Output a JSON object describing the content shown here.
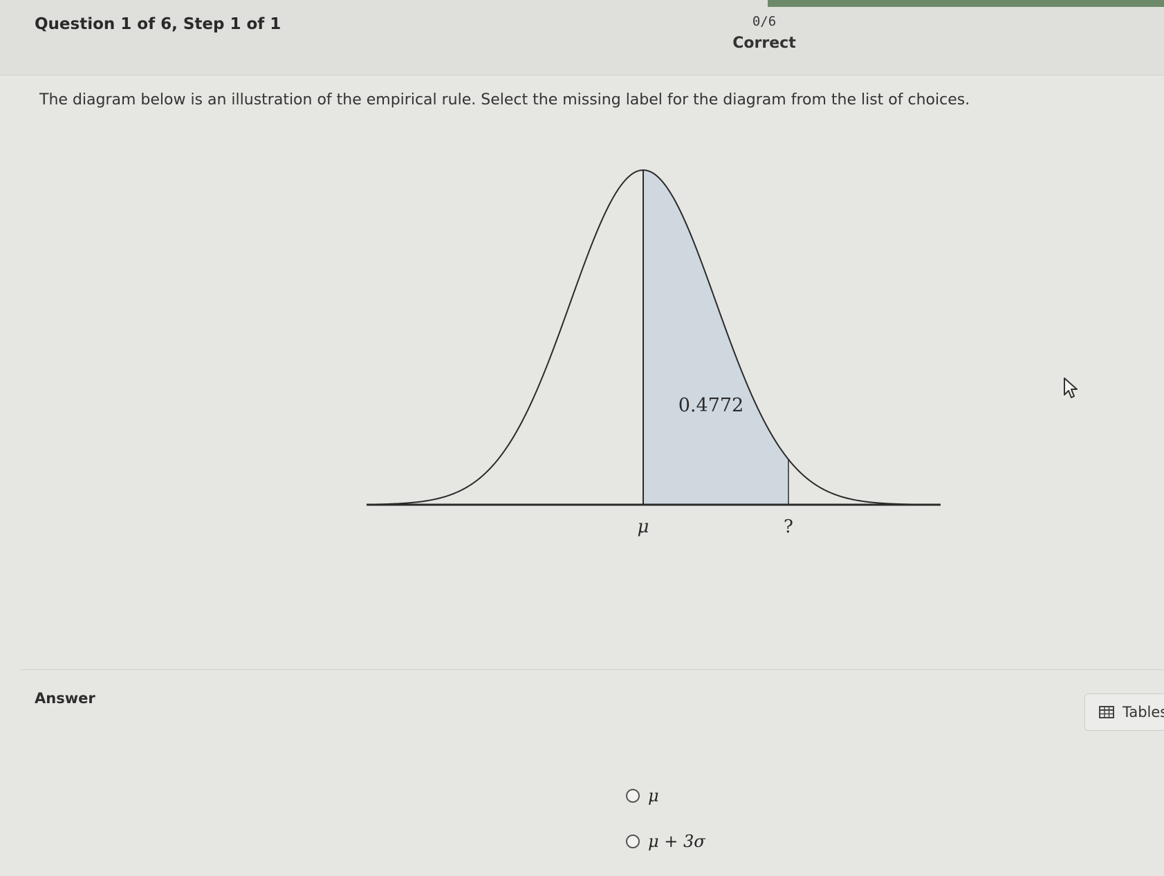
{
  "header": {
    "question_progress": "Question 1 of 6, Step 1 of 1",
    "score": "0/6",
    "score_label": "Correct"
  },
  "question": {
    "prompt": "The diagram below is an illustration of the empirical rule. Select the missing label for the diagram from the list of choices."
  },
  "diagram": {
    "shaded_area_label": "0.4772",
    "mean_label": "μ",
    "missing_label": "?"
  },
  "answer": {
    "label": "Answer",
    "tables_button": "Tables",
    "options": [
      {
        "label": "μ"
      },
      {
        "label": "μ + 3σ"
      }
    ]
  },
  "icons": {
    "tables": "table-grid-icon",
    "cursor": "mouse-pointer-icon"
  }
}
